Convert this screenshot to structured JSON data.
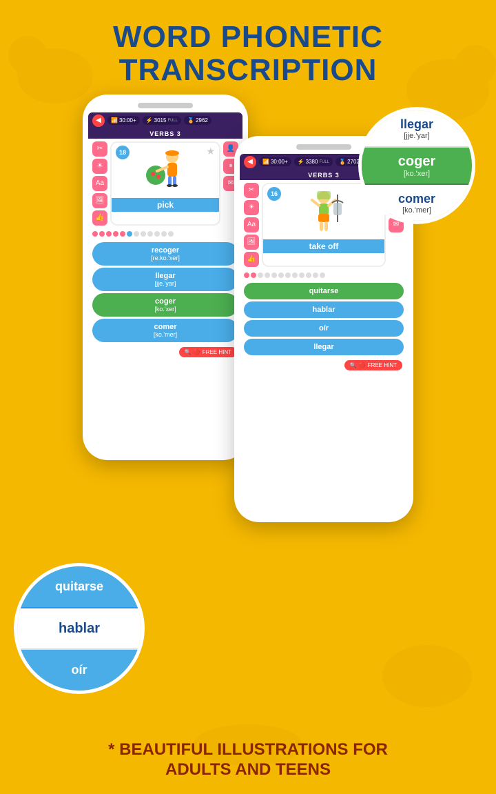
{
  "title": {
    "line1": "WORD PHONETIC",
    "line2": "TRANSCRIPTION"
  },
  "phone_left": {
    "bar": {
      "time": "30:00+",
      "xp": "3015",
      "xp_label": "FULL",
      "coins": "2962",
      "section": "VERBS 3"
    },
    "card": {
      "level": "18",
      "word": "pick"
    },
    "answers": [
      {
        "text": "recoger",
        "phonetic": "[re.ko.'xer]",
        "correct": false
      },
      {
        "text": "llegar",
        "phonetic": "[jje.'yar]",
        "correct": false
      },
      {
        "text": "coger",
        "phonetic": "[ko.'xer]",
        "correct": true
      },
      {
        "text": "comer",
        "phonetic": "[ko.'mer]",
        "correct": false
      }
    ],
    "hint": "FREE HINT"
  },
  "phone_right": {
    "bar": {
      "time": "30:00+",
      "xp": "3380",
      "xp_label": "FULL",
      "coins": "2702",
      "section": "VERBS 3"
    },
    "card": {
      "level": "16",
      "word": "take off"
    },
    "answers": [
      {
        "text": "quitarse",
        "phonetic": "",
        "correct": true
      },
      {
        "text": "hablar",
        "phonetic": "",
        "correct": false
      },
      {
        "text": "oír",
        "phonetic": "",
        "correct": false
      },
      {
        "text": "llegar",
        "phonetic": "",
        "correct": false
      }
    ],
    "hint": "FREE HINT"
  },
  "bubble_right": {
    "items": [
      {
        "text": "llegar",
        "phonetic": "[jje.'yar]",
        "style": "white"
      },
      {
        "text": "coger",
        "phonetic": "[ko.'xer]",
        "style": "green"
      },
      {
        "text": "comer",
        "phonetic": "[ko.'mer]",
        "style": "white"
      }
    ]
  },
  "bubble_left": {
    "items": [
      {
        "text": "quitarse",
        "phonetic": "",
        "style": "blue"
      },
      {
        "text": "hablar",
        "phonetic": "",
        "style": "white"
      },
      {
        "text": "oír",
        "phonetic": "",
        "style": "blue"
      }
    ]
  },
  "bottom_text": {
    "line1": "* BEAUTIFUL ILLUSTRATIONS FOR",
    "line2": "ADULTS AND TEENS"
  },
  "colors": {
    "background": "#F5B800",
    "title": "#1A4A8A",
    "bottom_text": "#8B2500",
    "phone_bar": "#3A2060",
    "answer_blue": "#4AADE8",
    "answer_green": "#4CAF50",
    "icon_pink": "#FF6B8A"
  }
}
